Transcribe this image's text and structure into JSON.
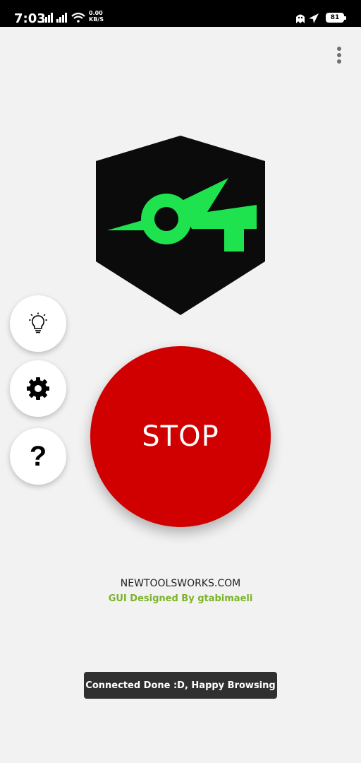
{
  "status_bar": {
    "time": "7:03",
    "net_speed_value": "0.00",
    "net_speed_unit": "KB/S",
    "battery": "81"
  },
  "header": {
    "menu_icon": "more-vert-icon"
  },
  "logo": {
    "icon": "app-logo-hexagon",
    "colors": {
      "shield": "#0b0b0b",
      "mark": "#1ee34f"
    }
  },
  "side_buttons": [
    {
      "icon": "lightbulb-icon"
    },
    {
      "icon": "gear-icon"
    },
    {
      "icon": "help-icon",
      "glyph": "?"
    }
  ],
  "main": {
    "stop_label": "STOP",
    "stop_color": "#d10000",
    "site": "NEWTOOLSWORKS.COM",
    "credit": "GUI  Designed By gtabimaeli",
    "credit_color": "#7cb32a"
  },
  "toast": {
    "message": "Connected Done :D, Happy Browsing"
  }
}
